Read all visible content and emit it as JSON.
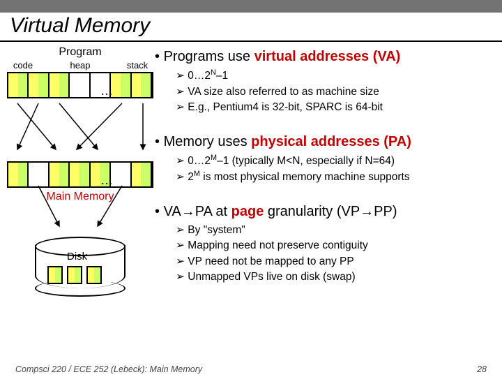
{
  "title": "Virtual Memory",
  "left": {
    "program_label": "Program",
    "seg_code": "code",
    "seg_heap": "heap",
    "seg_stack": "stack",
    "ellipsis": "…",
    "main_memory_label": "Main Memory",
    "disk_label": "Disk"
  },
  "bullets": {
    "b1": "Programs use ",
    "b1_red": "virtual addresses (VA)",
    "b1a_pre": "0…2",
    "b1a_sup": "N",
    "b1a_post": "–1",
    "b1b": "VA size also referred to as machine size",
    "b1c": "E.g., Pentium4 is 32-bit, SPARC is 64-bit",
    "b2": "Memory uses ",
    "b2_red": "physical addresses (PA)",
    "b2a_pre": "0…2",
    "b2a_sup": "M",
    "b2a_post": "–1 (typically M<N, especially if N=64)",
    "b2b_pre": "2",
    "b2b_sup": "M",
    "b2b_post": " is most physical memory machine supports",
    "b3_pre": "VA→PA at ",
    "b3_red": "page",
    "b3_post": " granularity (VP→PP)",
    "b3a": "By \"system\"",
    "b3b": "Mapping need not preserve contiguity",
    "b3c": "VP need not be mapped to any PP",
    "b3d": "Unmapped VPs live on disk (swap)"
  },
  "footer": {
    "left": "Compsci 220 / ECE 252 (Lebeck): Main Memory",
    "right": "28"
  }
}
